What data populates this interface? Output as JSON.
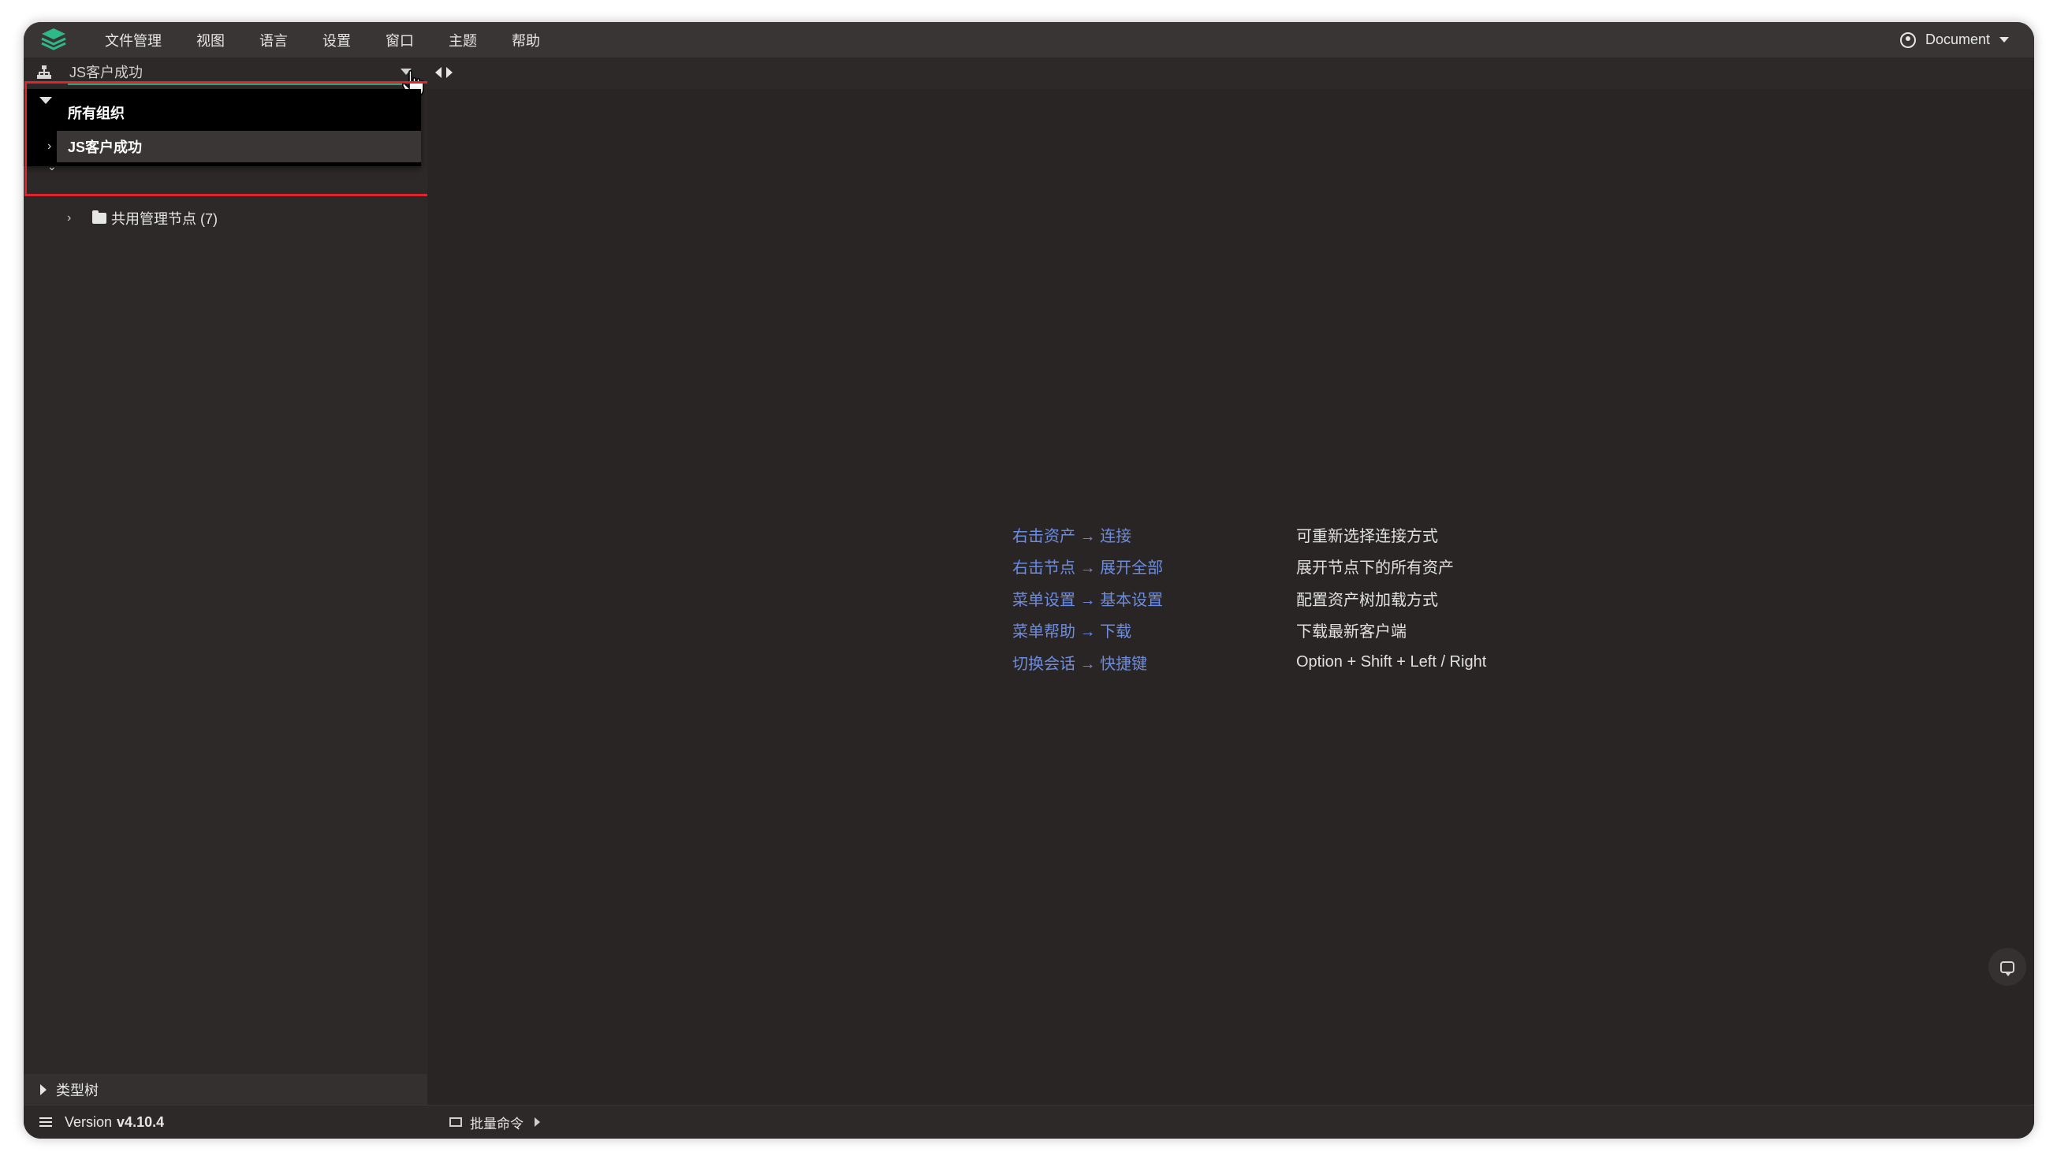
{
  "menu": {
    "items": [
      "文件管理",
      "视图",
      "语言",
      "设置",
      "窗口",
      "主题",
      "帮助"
    ],
    "user_label": "Document"
  },
  "sidebar": {
    "org_select": {
      "value": "JS客户成功"
    },
    "dropdown": {
      "items": [
        "所有组织",
        "JS客户成功"
      ],
      "selected": "JS客户成功"
    },
    "tree": {
      "node_label": "共用管理节点 (7)"
    },
    "type_tree_label": "类型树",
    "version": {
      "prefix": "Version",
      "number": "v4.10.4"
    }
  },
  "main": {
    "tips": [
      {
        "key": "右击资产 → 连接",
        "desc": "可重新选择连接方式"
      },
      {
        "key": "右击节点 → 展开全部",
        "desc": "展开节点下的所有资产"
      },
      {
        "key": "菜单设置 → 基本设置",
        "desc": "配置资产树加载方式"
      },
      {
        "key": "菜单帮助 → 下载",
        "desc": "下载最新客户端"
      },
      {
        "key": "切换会话 → 快捷键",
        "desc": "Option + Shift + Left / Right"
      }
    ],
    "bottom_bar": {
      "batch_command_label": "批量命令"
    }
  },
  "colors": {
    "background": "#2a2525",
    "accent_green": "#2fa37a",
    "tip_key_blue": "#6d8cdc",
    "highlight_red": "#e0242d"
  }
}
